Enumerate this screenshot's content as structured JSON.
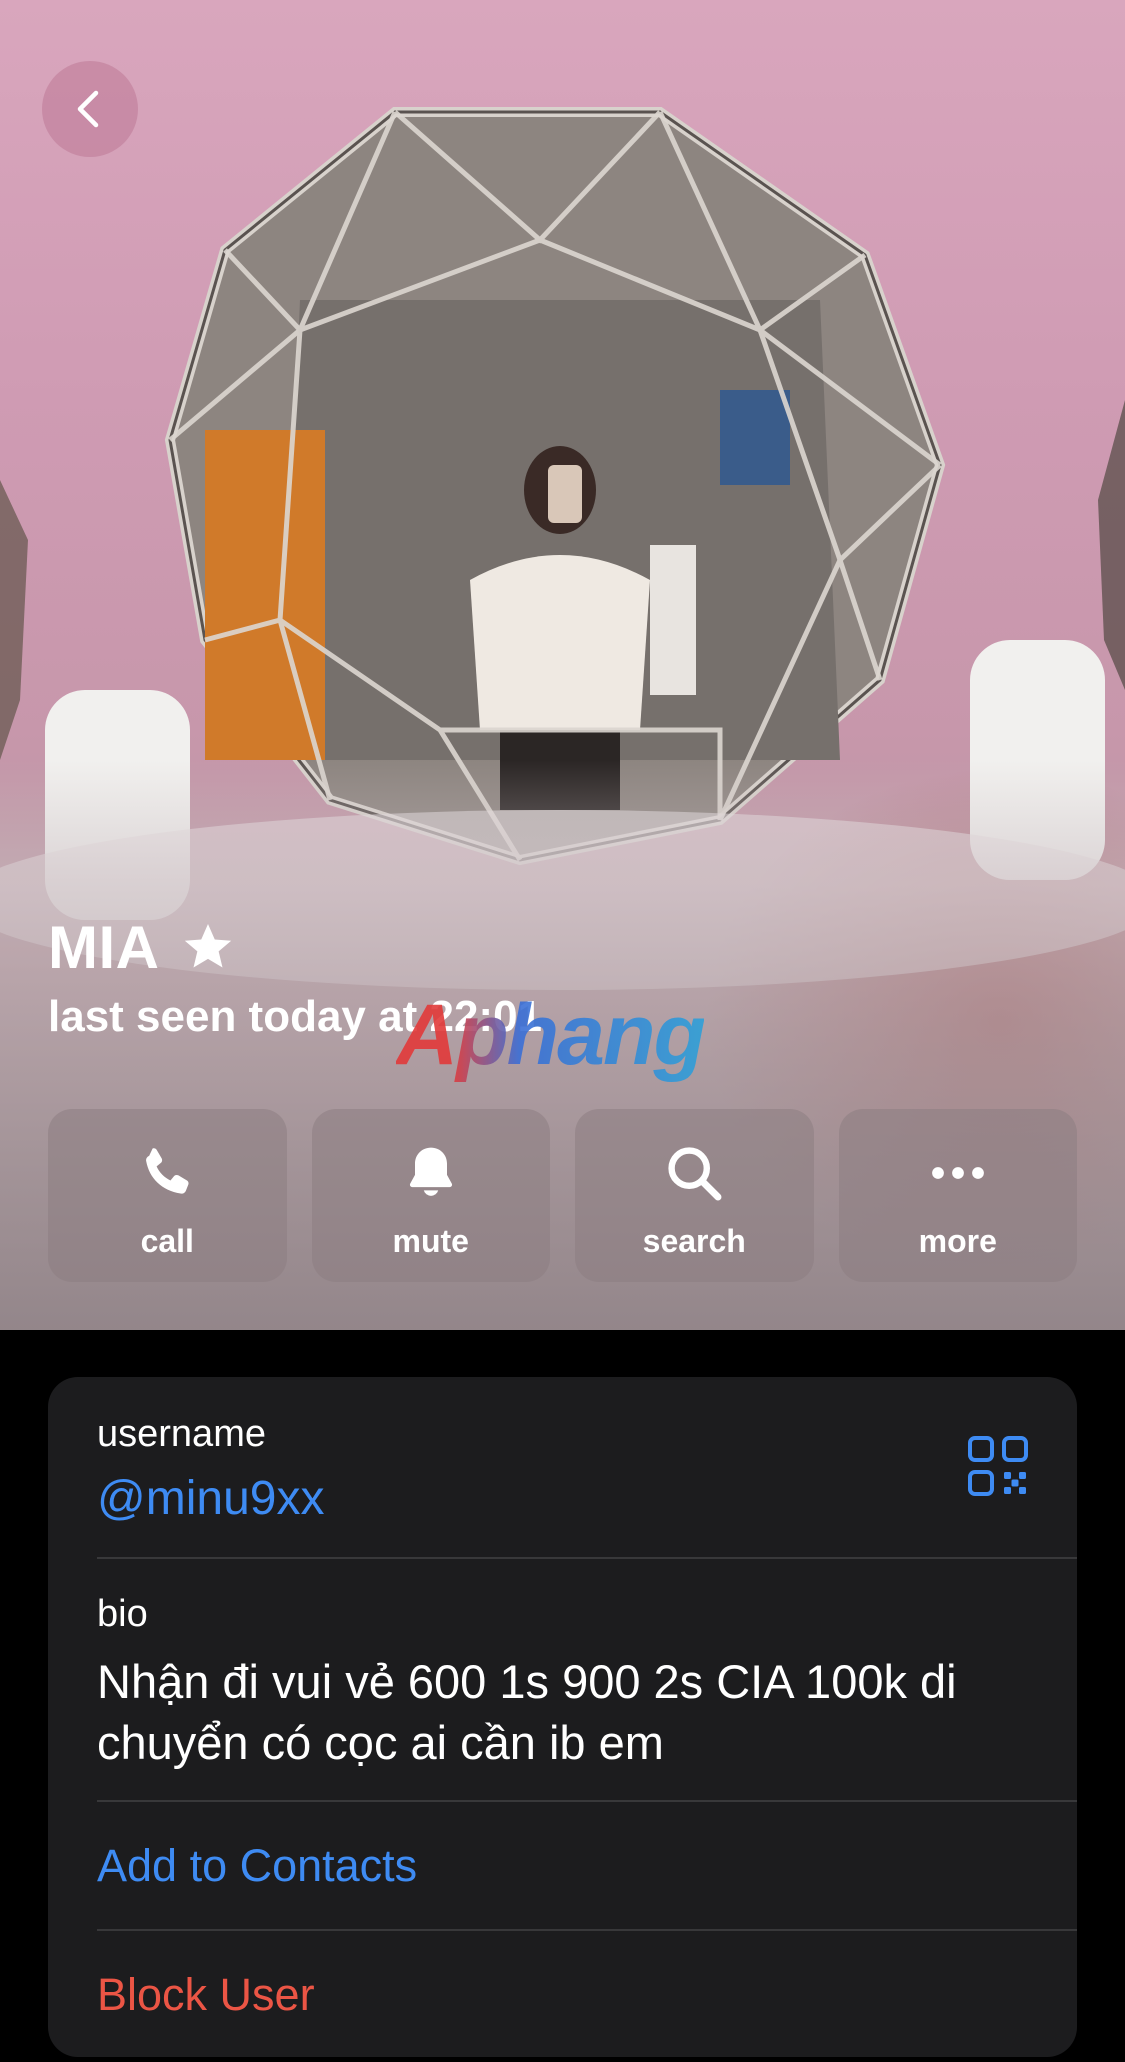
{
  "header": {
    "back_icon": "chevron-left-icon",
    "name": "MIA",
    "name_badge_icon": "star-icon",
    "status": "last seen today at 22:01",
    "watermark": "Aphang"
  },
  "actions": [
    {
      "label": "call",
      "icon": "phone-icon"
    },
    {
      "label": "mute",
      "icon": "bell-icon"
    },
    {
      "label": "search",
      "icon": "search-icon"
    },
    {
      "label": "more",
      "icon": "more-icon"
    }
  ],
  "info": {
    "username_label": "username",
    "username_value": "@minu9xx",
    "qr_icon": "qr-code-icon",
    "bio_label": "bio",
    "bio_value": "Nhận đi vui vẻ 600 1s 900 2s CIA 100k di chuyển có cọc ai cần ib em",
    "add_contact_label": "Add to Contacts",
    "block_label": "Block User"
  },
  "colors": {
    "link_blue": "#3e8bf3",
    "destructive_red": "#eb5545",
    "card_background": "#1c1c1e",
    "page_background": "#000000"
  }
}
